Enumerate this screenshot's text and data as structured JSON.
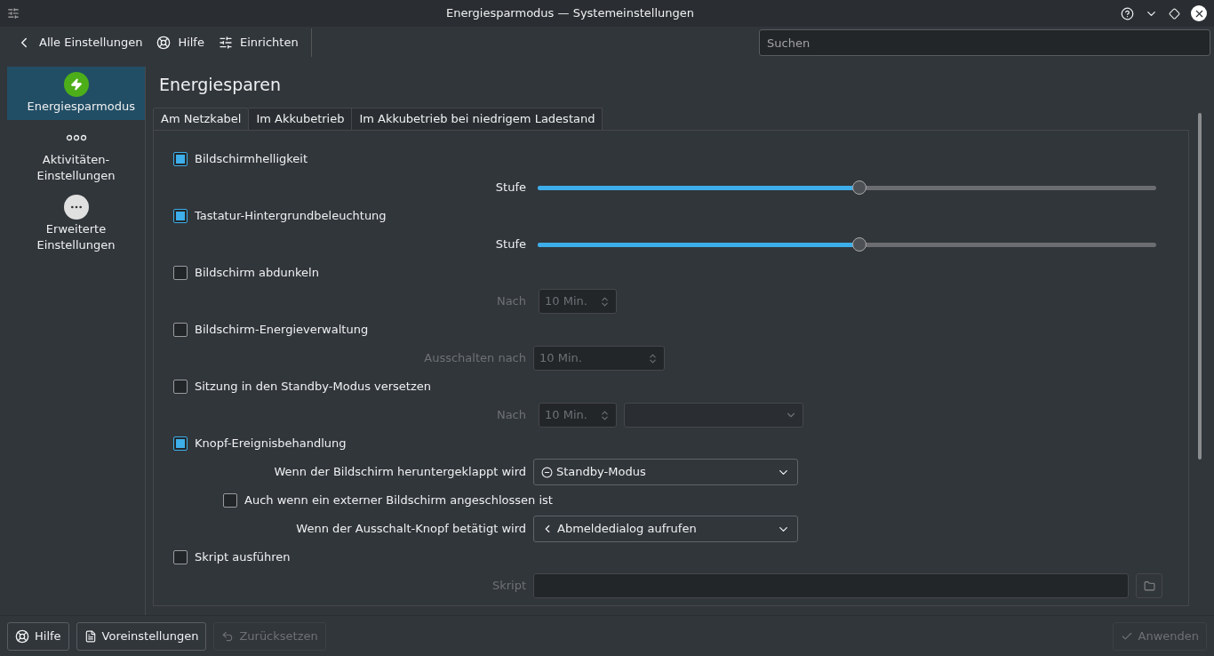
{
  "window": {
    "title": "Energiesparmodus — Systemeinstellungen"
  },
  "toolbar": [
    {
      "kind": "back",
      "label": "Alle Einstellungen"
    },
    {
      "kind": "help",
      "label": "Hilfe"
    },
    {
      "kind": "configure",
      "label": "Einrichten"
    }
  ],
  "search": {
    "placeholder": "Suchen"
  },
  "sidebar": {
    "items": [
      {
        "kind": "power",
        "label": "Energiesparmodus",
        "selected": true
      },
      {
        "kind": "activities",
        "label": "Aktivitäten-Einstellungen",
        "selected": false
      },
      {
        "kind": "more",
        "label": "Erweiterte Einstellungen",
        "selected": false
      }
    ]
  },
  "page_title": "Energiesparen",
  "tabs": [
    {
      "label": "Am Netzkabel",
      "selected": true
    },
    {
      "label": "Im Akkubetrieb",
      "selected": false
    },
    {
      "label": "Im Akkubetrieb bei niedrigem Ladestand",
      "selected": false
    }
  ],
  "settings": [
    {
      "kind": "check",
      "label": "Bildschirmhelligkeit",
      "checked": true
    },
    {
      "kind": "slider",
      "label": "Stufe",
      "level": 0.52
    },
    {
      "kind": "check",
      "label": "Tastatur-Hintergrundbeleuchtung",
      "checked": true
    },
    {
      "kind": "slider",
      "label": "Stufe",
      "level": 0.52
    },
    {
      "kind": "check",
      "label": "Bildschirm abdunkeln",
      "checked": false
    },
    {
      "kind": "spin",
      "label": "Nach",
      "value": "10 Min.",
      "disabled": true
    },
    {
      "kind": "check",
      "label": "Bildschirm-Energieverwaltung",
      "checked": false
    },
    {
      "kind": "spin",
      "label": "Ausschalten nach",
      "value": "10 Min.",
      "disabled": true,
      "wide": true
    },
    {
      "kind": "check",
      "label": "Sitzung in den Standby-Modus versetzen",
      "checked": false
    },
    {
      "kind": "spin",
      "label": "Nach",
      "value": "10 Min.",
      "disabled": true,
      "combo": true
    },
    {
      "kind": "check",
      "label": "Knopf-Ereignisbehandlung",
      "checked": true
    },
    {
      "kind": "combo",
      "label": "Wenn der Bildschirm heruntergeklappt wird",
      "value": "Standby-Modus"
    },
    {
      "kind": "subcheck",
      "label": "Auch wenn ein externer Bildschirm angeschlossen ist",
      "checked": false
    },
    {
      "kind": "combo",
      "label": "Wenn der Ausschalt-Knopf betätigt wird",
      "value": "Abmeldedialog aufrufen"
    },
    {
      "kind": "check",
      "label": "Skript ausführen",
      "checked": false
    },
    {
      "kind": "file",
      "label": "Skript",
      "disabled": true
    }
  ],
  "footer": [
    {
      "kind": "help",
      "label": "Hilfe",
      "disabled": false
    },
    {
      "kind": "defaults",
      "label": "Voreinstellungen",
      "disabled": false
    },
    {
      "kind": "reset",
      "label": "Zurücksetzen",
      "disabled": true
    },
    {
      "kind": "apply",
      "label": "Anwenden",
      "disabled": true
    }
  ]
}
